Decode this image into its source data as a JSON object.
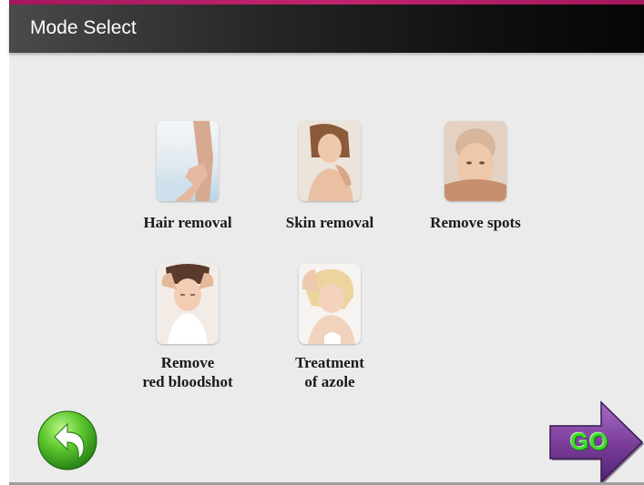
{
  "window": {
    "title": "Mode Select"
  },
  "modes": [
    {
      "label": "Hair removal",
      "icon": "hair-removal-photo-icon"
    },
    {
      "label": "Skin removal",
      "icon": "skin-removal-photo-icon"
    },
    {
      "label": "Remove spots",
      "icon": "remove-spots-photo-icon"
    },
    {
      "label": "Remove\nred bloodshot",
      "icon": "red-bloodshot-photo-icon"
    },
    {
      "label": "Treatment\nof azole",
      "icon": "azole-treatment-photo-icon"
    }
  ],
  "navigation": {
    "back_icon": "back-arrow-icon",
    "go_label": "GO"
  },
  "colors": {
    "accent_bar": "#b01e64",
    "background": "#ebebeb",
    "title_bar": "#101010",
    "go_arrow": "#7d3f9c",
    "go_text": "#3ddc2a",
    "back_button": "#3fb52b"
  }
}
